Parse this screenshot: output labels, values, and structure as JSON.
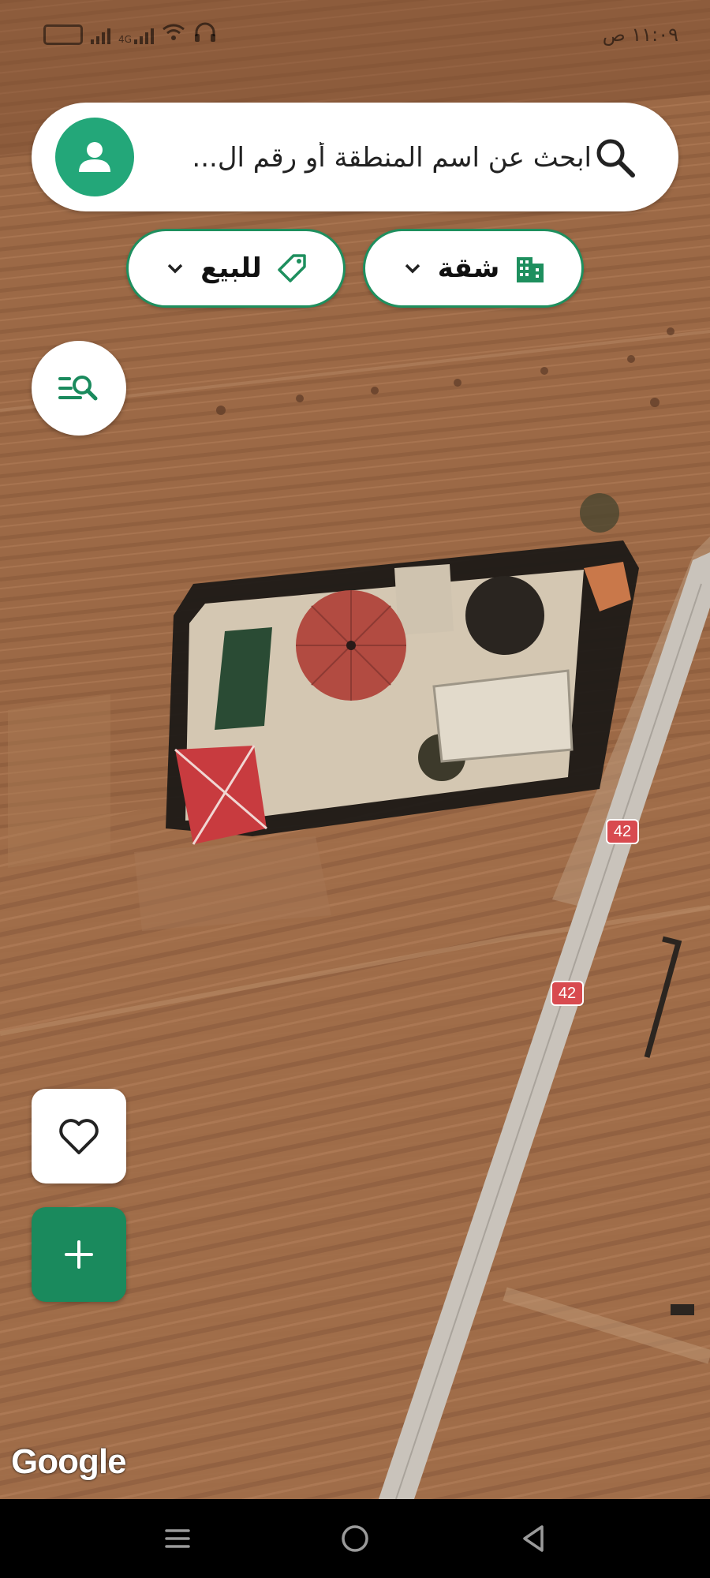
{
  "status_bar": {
    "time": "١١:٠٩ ص",
    "network_label": "4G",
    "icons": [
      "battery-icon",
      "signal-icon",
      "signal-4g-icon",
      "wifi-icon",
      "headphones-icon"
    ]
  },
  "search": {
    "placeholder": "ابحث عن اسم المنطقة أو رقم ال...",
    "value": ""
  },
  "filters": {
    "property_type": {
      "label": "شقة",
      "icon": "building-icon"
    },
    "listing_type": {
      "label": "للبيع",
      "icon": "tag-icon"
    }
  },
  "map": {
    "attribution": "Google",
    "road_shields": [
      "42",
      "42"
    ]
  },
  "buttons": {
    "filter_search_icon": "list-search-icon",
    "favorites_icon": "heart-icon",
    "add_icon": "plus-icon"
  },
  "navigation": {
    "items": [
      "menu-icon",
      "home-icon",
      "back-icon"
    ]
  },
  "colors": {
    "accent": "#23a779",
    "accent_dark": "#1a8a5d",
    "road_shield": "#d84a4f"
  }
}
